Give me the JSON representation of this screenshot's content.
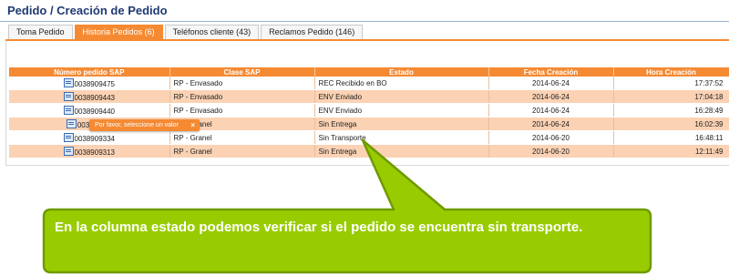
{
  "page": {
    "title": "Pedido / Creación de Pedido"
  },
  "tabs": [
    {
      "label": "Toma Pedido",
      "active": false
    },
    {
      "label": "Historia Pedidos (6)",
      "active": true
    },
    {
      "label": "Teléfonos cliente (43)",
      "active": false
    },
    {
      "label": "Reclamos Pedido (146)",
      "active": false
    }
  ],
  "table": {
    "headers": [
      "Número pedido SAP",
      "Clase SAP",
      "Estado",
      "Fecha Creación",
      "Hora Creación"
    ],
    "rows": [
      {
        "numero": "0038909475",
        "clase": "RP - Envasado",
        "estado": "REC Recibido en BO",
        "fecha": "2014-06-24",
        "hora": "17:37:52"
      },
      {
        "numero": "0038909443",
        "clase": "RP - Envasado",
        "estado": "ENV Enviado",
        "fecha": "2014-06-24",
        "hora": "17:04:18"
      },
      {
        "numero": "0038909440",
        "clase": "RP - Envasado",
        "estado": "ENV Enviado",
        "fecha": "2014-06-24",
        "hora": "16:28:49"
      },
      {
        "numero": "0038909...",
        "clase": "RP - Granel",
        "estado": "Sin Entrega",
        "fecha": "2014-06-24",
        "hora": "16:02:39"
      },
      {
        "numero": "0038909334",
        "clase": "RP - Granel",
        "estado": "Sin Transporte",
        "fecha": "2014-06-20",
        "hora": "16:48:11"
      },
      {
        "numero": "0038909313",
        "clase": "RP - Granel",
        "estado": "Sin Entrega",
        "fecha": "2014-06-20",
        "hora": "12:11:49"
      }
    ]
  },
  "tooltip": {
    "text": "Por favor, seleccione un valor",
    "close": "×"
  },
  "callout": {
    "text": "En la columna estado podemos verificar si el pedido se encuentra sin transporte.",
    "color": "#99cc00",
    "border": "#6f9a00"
  },
  "colors": {
    "accent": "#f58a33",
    "row_alt": "#fbd2b4",
    "title": "#1f3a73"
  },
  "icons": {
    "row_icon": "document-edit-icon"
  }
}
